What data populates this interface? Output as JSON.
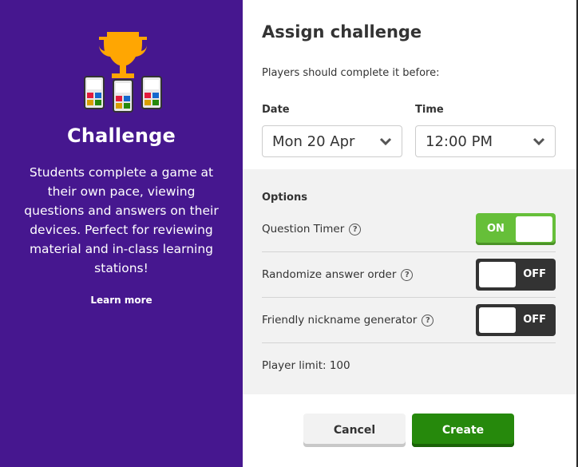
{
  "left": {
    "title": "Challenge",
    "description": "Students complete a game at their own pace, viewing questions and answers on their devices. Perfect for reviewing material and in-class learning stations!",
    "learn_more": "Learn more",
    "illustration": "trophy-with-phones"
  },
  "right": {
    "title": "Assign challenge",
    "subtitle": "Players should complete it before:",
    "date": {
      "label": "Date",
      "value": "Mon 20 Apr"
    },
    "time": {
      "label": "Time",
      "value": "12:00 PM"
    },
    "options": {
      "heading": "Options",
      "items": [
        {
          "label": "Question Timer",
          "state": "ON"
        },
        {
          "label": "Randomize answer order",
          "state": "OFF"
        },
        {
          "label": "Friendly nickname generator",
          "state": "OFF"
        }
      ],
      "help_glyph": "?",
      "player_limit": "Player limit: 100"
    },
    "buttons": {
      "cancel": "Cancel",
      "create": "Create"
    }
  },
  "colors": {
    "left_bg": "#46178f",
    "toggle_on": "#66bf39",
    "toggle_off": "#333333",
    "create": "#26890c",
    "trophy": "#ffa602"
  }
}
